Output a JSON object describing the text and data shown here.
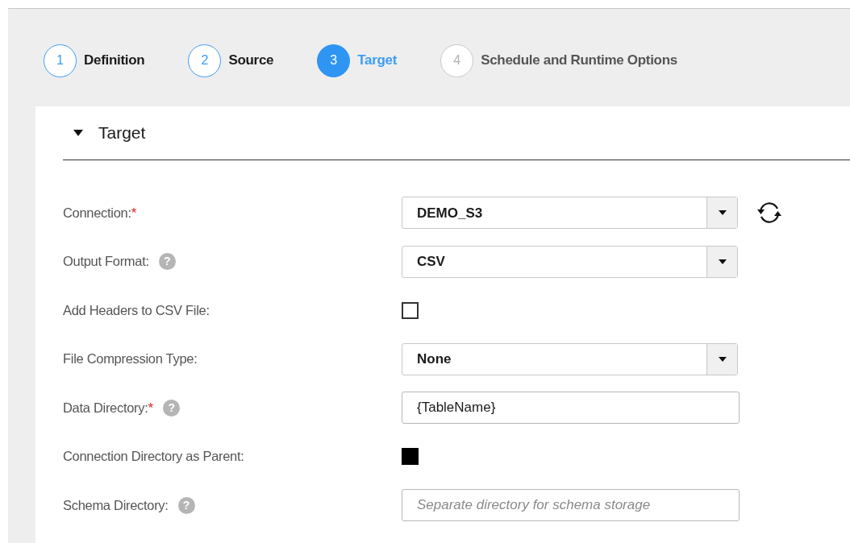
{
  "steps": [
    {
      "number": "1",
      "label": "Definition",
      "completed": true,
      "selected": false
    },
    {
      "number": "2",
      "label": "Source",
      "completed": true,
      "selected": false
    },
    {
      "number": "3",
      "label": "Target",
      "selected": true
    },
    {
      "number": "4",
      "label": "Schedule and Runtime Options",
      "completed": false,
      "selected": false
    }
  ],
  "section": {
    "title": "Target",
    "expanded": true,
    "fields": [
      {
        "kind": "dropdown",
        "label": "Connection:",
        "required_mark": "*",
        "value": "DEMO_S3",
        "refresh": true
      },
      {
        "kind": "dropdown",
        "label": "Output Format:",
        "help": "?",
        "value": "CSV"
      },
      {
        "kind": "checkbox",
        "label": "Add Headers to CSV File:",
        "checked": false
      },
      {
        "kind": "dropdown",
        "label": "File Compression Type:",
        "value": "None"
      },
      {
        "kind": "text",
        "label": "Data Directory:",
        "required_mark": "*",
        "help": "?",
        "value": "{TableName}"
      },
      {
        "kind": "checkbox",
        "label": "Connection Directory as Parent:",
        "checked": true
      },
      {
        "kind": "text",
        "label": "Schema Directory:",
        "help": "?",
        "placeholder": "Separate directory for schema storage"
      }
    ]
  }
}
